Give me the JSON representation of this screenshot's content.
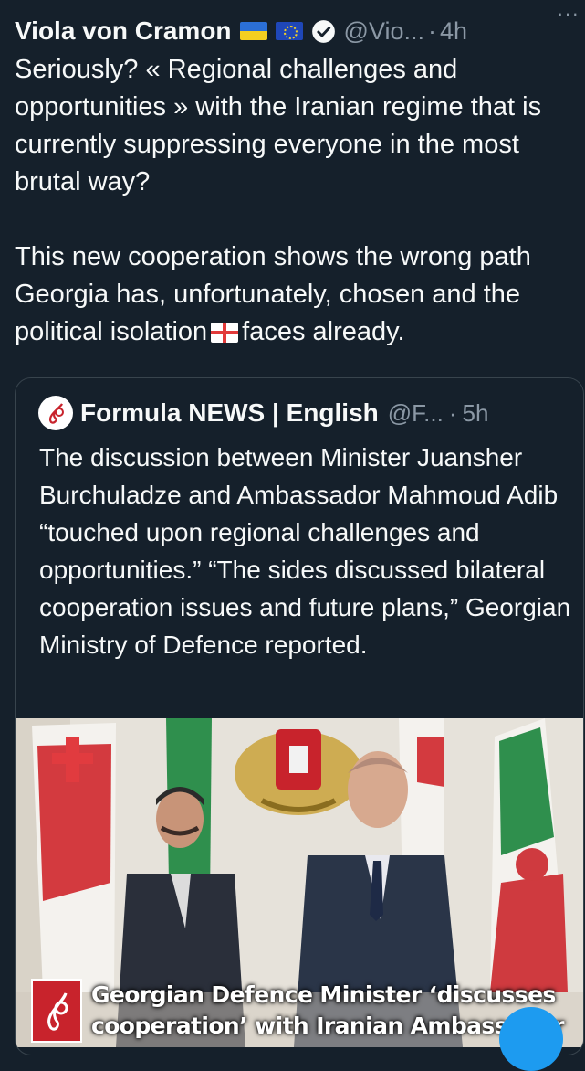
{
  "tweet": {
    "author_name": "Viola von Cramon",
    "flags": [
      "flag-ukraine-icon",
      "flag-eu-icon"
    ],
    "handle": "@Vio...",
    "separator": "·",
    "time": "4h",
    "more": "···",
    "text_p1": "Seriously? « Regional challenges and opportunities » with the Iranian regime that is currently suppressing everyone in the most brutal way?",
    "text_p2_a": "This new cooperation shows the wrong path Georgia has, unfortunately, chosen and the political isolation",
    "text_p2_b": "faces already."
  },
  "quote": {
    "name": "Formula NEWS | English",
    "handle": "@F...",
    "separator": "·",
    "time": "5h",
    "text": "The discussion between  Minister Juansher Burchuladze and Ambassador Mahmoud Adib “touched upon regional challenges and opportunities.” “The sides discussed bilateral cooperation issues and future plans,” Georgian Ministry of Defence reported.",
    "caption_line1": "Georgian Defence Minister ‘discusses",
    "caption_line2": "cooperation’ with Iranian Ambassador"
  },
  "colors": {
    "background": "#15202b",
    "text": "#f7f9f9",
    "muted": "#8b98a5",
    "border": "#38444d",
    "accent": "#1d9bf0"
  }
}
